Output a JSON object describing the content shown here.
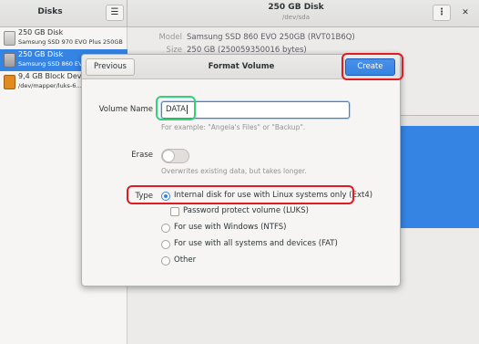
{
  "headerbar": {
    "sidebar_title": "Disks",
    "menu_icon": "hamburger-icon",
    "title": "250 GB Disk",
    "subtitle": "/dev/sda",
    "kebab_icon": "kebab-menu-icon",
    "close_icon": "close-icon"
  },
  "sidebar": {
    "items": [
      {
        "name": "250 GB Disk",
        "sub": "Samsung SSD 970 EVO Plus 250GB",
        "icon": "ssd-icon"
      },
      {
        "name": "250 GB Disk",
        "sub": "Samsung SSD 860 EVO 250GB",
        "icon": "ssd-icon"
      },
      {
        "name": "9,4 GB Block Device",
        "sub": "/dev/mapper/luks-6…",
        "icon": "block-device-icon"
      }
    ]
  },
  "details": {
    "model_label": "Model",
    "model_value": "Samsung SSD 860 EVO 250GB (RVT01B6Q)",
    "size_label": "Size",
    "size_value": "250 GB (250059350016 bytes)"
  },
  "dialog": {
    "title": "Format Volume",
    "previous_label": "Previous",
    "create_label": "Create",
    "volume_name_label": "Volume Name",
    "volume_name_value": "DATA",
    "volume_name_hint": "For example: \"Angela's Files\" or \"Backup\".",
    "erase_label": "Erase",
    "erase_hint": "Overwrites existing data, but takes longer.",
    "type_label": "Type",
    "type_options": [
      "Internal disk for use with Linux systems only (Ext4)",
      "For use with Windows (NTFS)",
      "For use with all systems and devices (FAT)",
      "Other"
    ],
    "password_protect_label": "Password protect volume (LUKS)"
  },
  "colors": {
    "accent": "#3584e4",
    "annotation_red": "#e01b24",
    "annotation_green": "#33d17a"
  }
}
